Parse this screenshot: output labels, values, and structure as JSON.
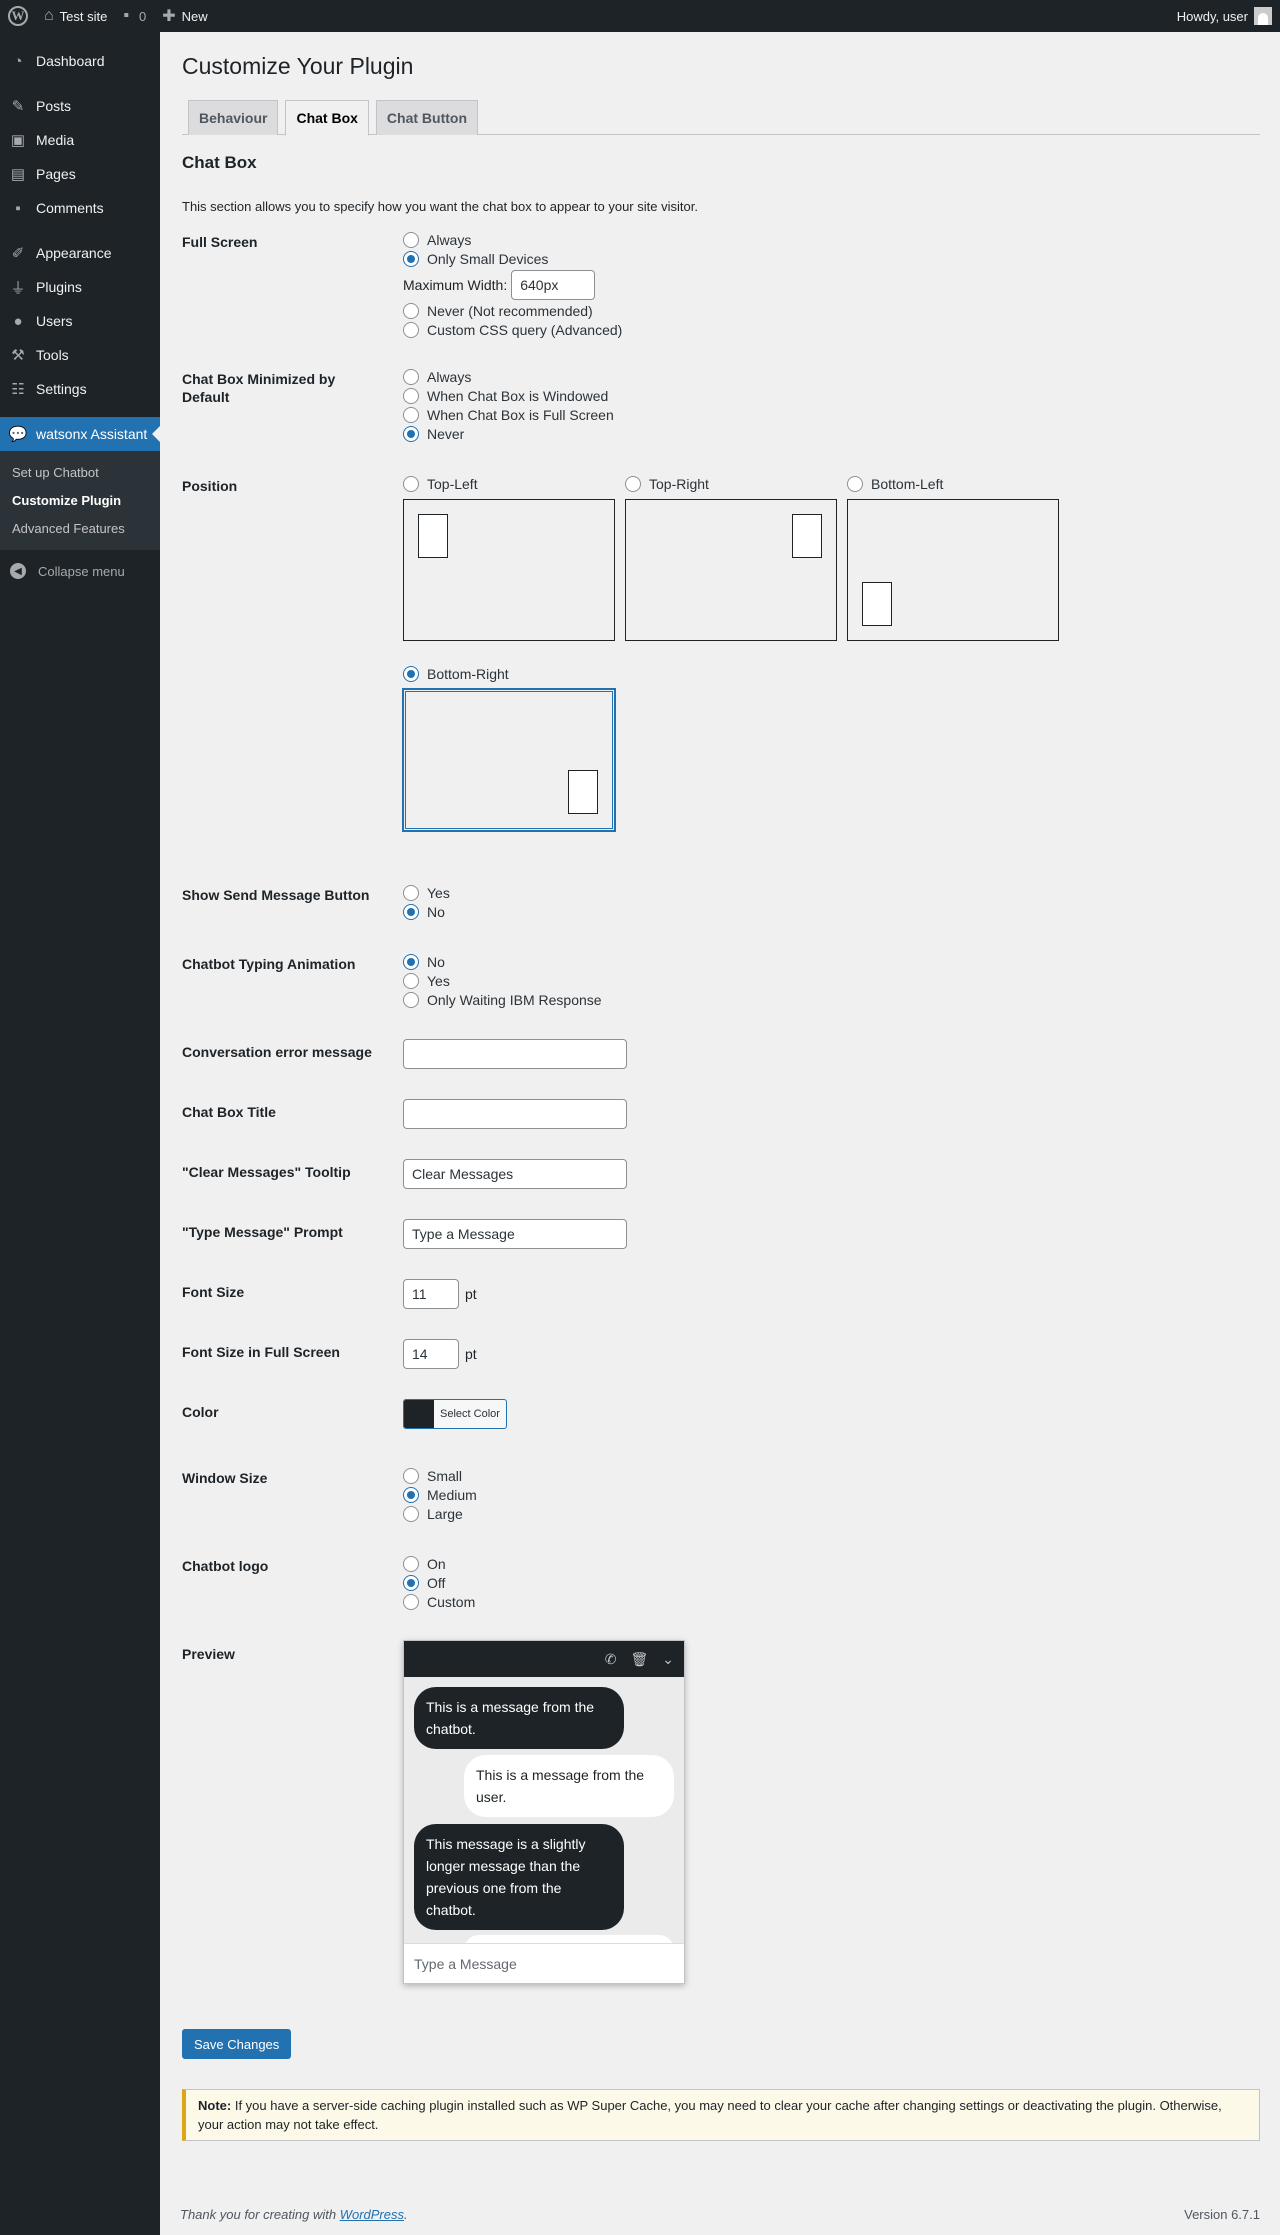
{
  "adminbar": {
    "site_name": "Test site",
    "comments_count": "0",
    "new_label": "New",
    "howdy": "Howdy, user"
  },
  "sidebar": {
    "items": [
      {
        "label": "Dashboard",
        "icon": "dashboard-icon"
      },
      {
        "label": "Posts",
        "icon": "pin-icon"
      },
      {
        "label": "Media",
        "icon": "media-icon"
      },
      {
        "label": "Pages",
        "icon": "pages-icon"
      },
      {
        "label": "Comments",
        "icon": "comment-icon"
      },
      {
        "label": "Appearance",
        "icon": "brush-icon"
      },
      {
        "label": "Plugins",
        "icon": "plug-icon"
      },
      {
        "label": "Users",
        "icon": "user-icon"
      },
      {
        "label": "Tools",
        "icon": "wrench-icon"
      },
      {
        "label": "Settings",
        "icon": "settings-icon"
      },
      {
        "label": "watsonx Assistant",
        "icon": "chat-icon"
      }
    ],
    "submenu": [
      "Set up Chatbot",
      "Customize Plugin",
      "Advanced Features"
    ],
    "collapse": "Collapse menu"
  },
  "page": {
    "title": "Customize Your Plugin",
    "tabs": [
      "Behaviour",
      "Chat Box",
      "Chat Button"
    ],
    "section_title": "Chat Box",
    "description": "This section allows you to specify how you want the chat box to appear to your site visitor."
  },
  "fields": {
    "full_screen": {
      "label": "Full Screen",
      "options": [
        "Always",
        "Only Small Devices",
        "Never (Not recommended)",
        "Custom CSS query (Advanced)"
      ],
      "selected": "Only Small Devices",
      "max_width_label": "Maximum Width:",
      "max_width_value": "640px"
    },
    "minimized": {
      "label": "Chat Box Minimized by Default",
      "options": [
        "Always",
        "When Chat Box is Windowed",
        "When Chat Box is Full Screen",
        "Never"
      ],
      "selected": "Never"
    },
    "position": {
      "label": "Position",
      "options": [
        "Top-Left",
        "Top-Right",
        "Bottom-Left",
        "Bottom-Right"
      ],
      "selected": "Bottom-Right"
    },
    "send_button": {
      "label": "Show Send Message Button",
      "options": [
        "Yes",
        "No"
      ],
      "selected": "No"
    },
    "typing": {
      "label": "Chatbot Typing Animation",
      "options": [
        "No",
        "Yes",
        "Only Waiting IBM Response"
      ],
      "selected": "No"
    },
    "error_message": {
      "label": "Conversation error message",
      "value": ""
    },
    "chat_title": {
      "label": "Chat Box Title",
      "value": ""
    },
    "clear_tooltip": {
      "label": "\"Clear Messages\" Tooltip",
      "value": "Clear Messages"
    },
    "type_prompt": {
      "label": "\"Type Message\" Prompt",
      "value": "Type a Message"
    },
    "font_size": {
      "label": "Font Size",
      "value": "11",
      "unit": "pt"
    },
    "font_size_full": {
      "label": "Font Size in Full Screen",
      "value": "14",
      "unit": "pt"
    },
    "color": {
      "label": "Color",
      "button": "Select Color",
      "value": "#1d2327"
    },
    "window_size": {
      "label": "Window Size",
      "options": [
        "Small",
        "Medium",
        "Large"
      ],
      "selected": "Medium"
    },
    "logo": {
      "label": "Chatbot logo",
      "options": [
        "On",
        "Off",
        "Custom"
      ],
      "selected": "Off"
    },
    "preview": {
      "label": "Preview",
      "messages": [
        {
          "from": "bot",
          "text": "This is a message from the chatbot."
        },
        {
          "from": "user",
          "text": "This is a message from the user."
        },
        {
          "from": "bot",
          "text": "This message is a slightly longer message than the previous one from the chatbot."
        }
      ],
      "input_placeholder": "Type a Message"
    }
  },
  "save_label": "Save Changes",
  "notice": {
    "strong": "Note:",
    "text": " If you have a server-side caching plugin installed such as WP Super Cache, you may need to clear your cache after changing settings or deactivating the plugin. Otherwise, your action may not take effect."
  },
  "footer": {
    "thanks_prefix": "Thank you for creating with ",
    "thanks_link": "WordPress",
    "thanks_suffix": ".",
    "version": "Version 6.7.1"
  }
}
